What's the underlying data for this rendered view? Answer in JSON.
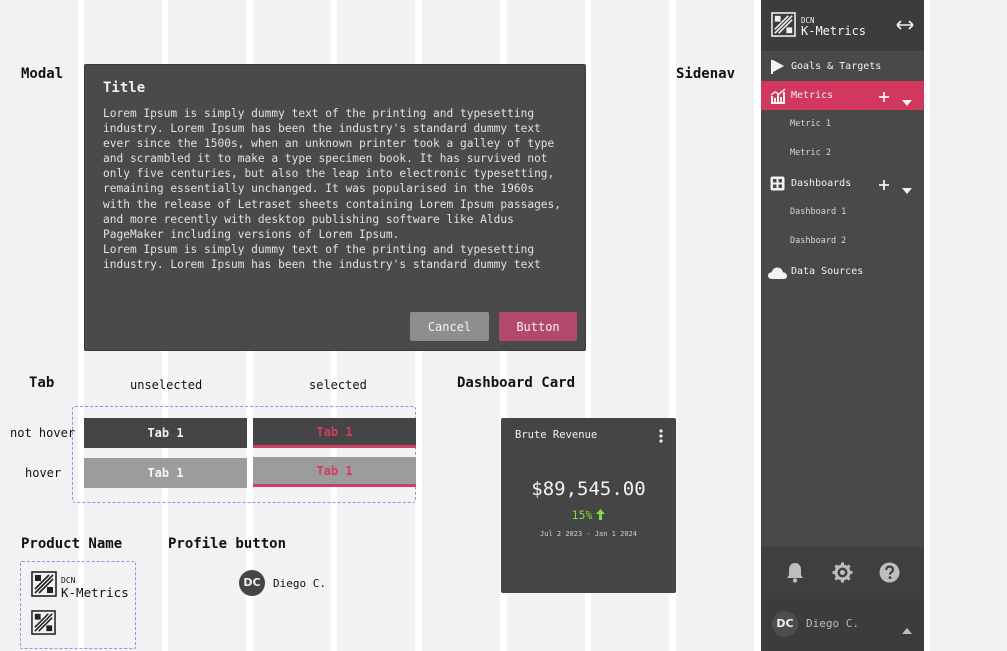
{
  "sections": {
    "modal": "Modal",
    "sidenav": "Sidenav",
    "tab": "Tab",
    "dashboard_card": "Dashboard Card",
    "product_name": "Product Name",
    "profile_button": "Profile button"
  },
  "modal": {
    "title": "Title",
    "paragraphs": [
      "Lorem Ipsum is simply dummy text of the printing and typesetting industry. Lorem Ipsum has been the industry's standard dummy text ever since the 1500s, when an unknown printer took a galley of type and scrambled it to make a type specimen book. It has survived not only five centuries, but also the leap into electronic typesetting, remaining essentially unchanged. It was popularised in the 1960s with the release of Letraset sheets containing Lorem Ipsum passages, and more recently with desktop publishing software like Aldus PageMaker including versions of Lorem Ipsum.",
      "Lorem Ipsum is simply dummy text of the printing and typesetting industry. Lorem Ipsum has been the industry's standard dummy text"
    ],
    "cancel_label": "Cancel",
    "primary_label": "Button"
  },
  "tabs": {
    "unselected_label": "unselected",
    "selected_label": "selected",
    "not_hover_label": "not hover",
    "hover_label": "hover",
    "tab_text": "Tab 1",
    "accent_color": "#d23d63"
  },
  "card": {
    "title": "Brute Revenue",
    "value": "$89,545.00",
    "change": "15%",
    "change_direction": "up-arrow-icon",
    "date_range": "Jul 2 2023 - Jan 1 2024",
    "change_color": "#7ddc3f"
  },
  "brand": {
    "small": "DCN",
    "name": "K-Metrics"
  },
  "profile": {
    "initials": "DC",
    "name": "Diego C."
  },
  "sidenav": {
    "items": [
      {
        "label": "Goals & Targets",
        "icon": "flag-icon"
      },
      {
        "label": "Metrics",
        "icon": "chart-icon",
        "active": true
      },
      {
        "label": "Dashboards",
        "icon": "grid-icon"
      },
      {
        "label": "Data Sources",
        "icon": "cloud-icon"
      }
    ],
    "metric_subitems": [
      "Metric 1",
      "Metric 2"
    ],
    "dashboard_subitems": [
      "Dashboard 1",
      "Dashboard 2"
    ],
    "bottom_icons": [
      "bell-icon",
      "gear-icon",
      "help-icon"
    ],
    "active_color": "#d2385e"
  }
}
